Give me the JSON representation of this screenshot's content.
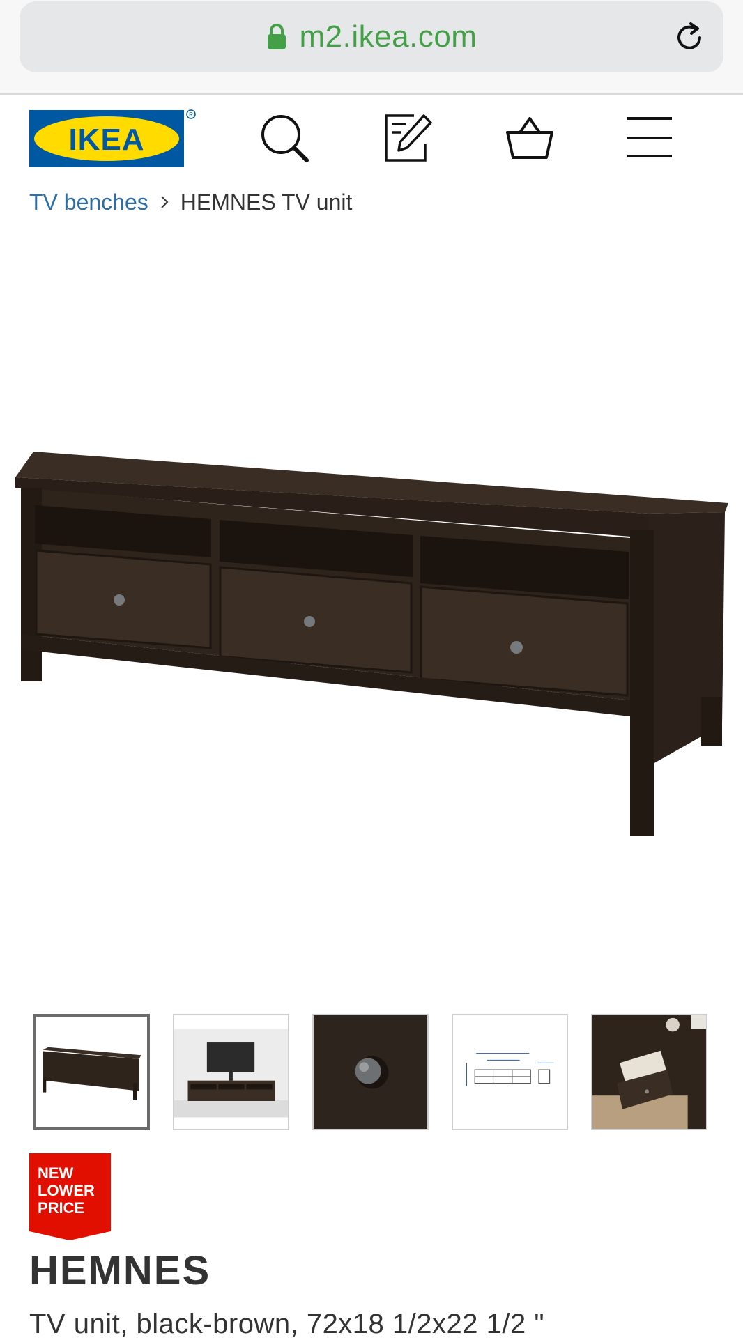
{
  "browser": {
    "url": "m2.ikea.com",
    "lock_icon": "lock-icon",
    "reload_icon": "reload-icon",
    "url_color": "#43a047"
  },
  "header": {
    "logo_text": "IKEA",
    "icons": [
      "search-icon",
      "shopping-list-icon",
      "shopping-bag-icon",
      "menu-icon"
    ],
    "brand_colors": {
      "blue": "#0058a3",
      "yellow": "#ffdb00"
    }
  },
  "breadcrumb": {
    "parent": "TV benches",
    "current": "HEMNES TV unit"
  },
  "gallery": {
    "selected_index": 0,
    "thumbnails": [
      "product-front",
      "room-setting",
      "knob-detail",
      "dimensions-drawing",
      "open-drawer-detail"
    ]
  },
  "badge": {
    "lines": [
      "NEW",
      "LOWER",
      "PRICE"
    ],
    "color": "#e00f00"
  },
  "product": {
    "name": "HEMNES",
    "description": "TV unit, black-brown, 72x18 1/2x22 1/2 \""
  }
}
